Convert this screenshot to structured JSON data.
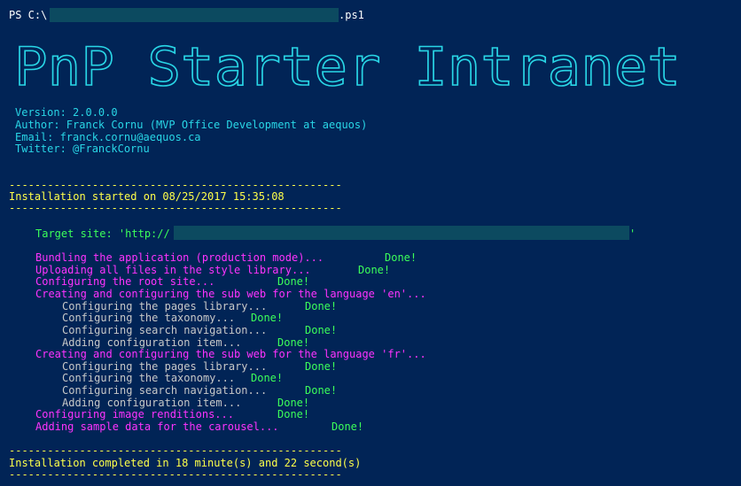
{
  "prompt": {
    "prefix": "PS C:\\",
    "suffix": ".ps1"
  },
  "banner": {
    "text": "PnP Starter Intranet"
  },
  "info": {
    "version": "Version: 2.0.0.0",
    "author": "Author: Franck Cornu (MVP Office Development at aequos)",
    "email": "Email: franck.cornu@aequos.ca",
    "twitter": "Twitter: @FranckCornu"
  },
  "separator": "----------------------------------------------------",
  "install_started": "Installation started on 08/25/2017 15:35:08",
  "target_site": {
    "prefix": "Target site: 'http://",
    "suffix": "'"
  },
  "steps": [
    {
      "text": "Bundling the application (production mode)...",
      "done": "Done!"
    },
    {
      "text": "Uploading all files in the style library...",
      "done": "Done!"
    },
    {
      "text": "Configuring the root site...",
      "done": "Done!"
    },
    {
      "text": "Creating and configuring the sub web for the language 'en'..."
    },
    {
      "text": "Configuring the pages library...",
      "done": "Done!"
    },
    {
      "text": "Configuring the taxonomy...",
      "done": "Done!"
    },
    {
      "text": "Configuring search navigation...",
      "done": "Done!"
    },
    {
      "text": "Adding configuration item...",
      "done": "Done!"
    },
    {
      "text": "Creating and configuring the sub web for the language 'fr'..."
    },
    {
      "text": "Configuring the pages library...",
      "done": "Done!"
    },
    {
      "text": "Configuring the taxonomy...",
      "done": "Done!"
    },
    {
      "text": "Configuring search navigation...",
      "done": "Done!"
    },
    {
      "text": "Adding configuration item...",
      "done": "Done!"
    },
    {
      "text": "Configuring image renditions...",
      "done": "Done!"
    },
    {
      "text": "Adding sample data for the carousel...",
      "done": "Done!"
    }
  ],
  "install_completed": "Installation completed in 18 minute(s) and 22 second(s)"
}
